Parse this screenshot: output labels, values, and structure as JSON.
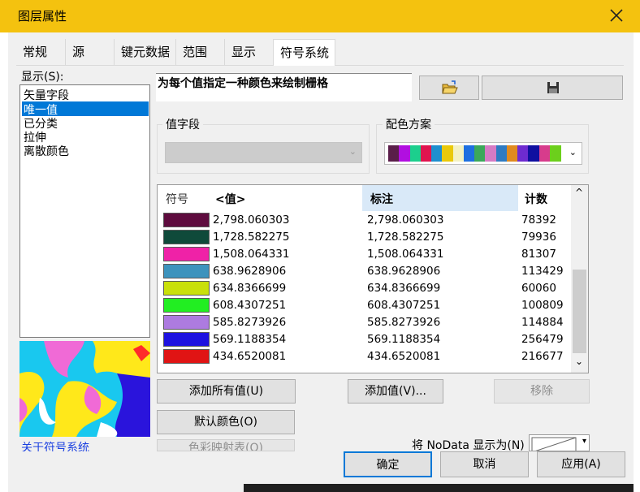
{
  "window": {
    "title": "图层属性"
  },
  "tabs": [
    "常规",
    "源",
    "键元数据",
    "范围",
    "显示",
    "符号系统"
  ],
  "show_label": "显示(S):",
  "renderers": [
    "矢量字段",
    "唯一值",
    "已分类",
    "拉伸",
    "离散颜色"
  ],
  "selected_renderer": 1,
  "description": "为每个值指定一种颜色来绘制栅格",
  "value_field": {
    "label": "值字段",
    "value": ""
  },
  "color_scheme": {
    "label": "配色方案",
    "colors": [
      "#5a1e4a",
      "#b10fe0",
      "#1ccf8d",
      "#e0144f",
      "#1e8fcf",
      "#eac90a",
      "#f3f1c3",
      "#1e6fe0",
      "#3ba85a",
      "#d67bc4",
      "#2f7bc2",
      "#e08a1e",
      "#6e2bd0",
      "#0f0fa0",
      "#d73c8c",
      "#6ccf1c"
    ]
  },
  "table": {
    "headers": {
      "symbol": "符号",
      "value": "<值>",
      "label": "标注",
      "count": "计数"
    },
    "rows": [
      {
        "color": "#5e0b3e",
        "value": "2,798.060303",
        "label": "2,798.060303",
        "count": "78392"
      },
      {
        "color": "#0f4a3a",
        "value": "1,728.582275",
        "label": "1,728.582275",
        "count": "79936"
      },
      {
        "color": "#ef22a7",
        "value": "1,508.064331",
        "label": "1,508.064331",
        "count": "81307"
      },
      {
        "color": "#3d93bd",
        "value": "638.9628906",
        "label": "638.9628906",
        "count": "113429"
      },
      {
        "color": "#c9e00a",
        "value": "634.8366699",
        "label": "634.8366699",
        "count": "60060"
      },
      {
        "color": "#22ee22",
        "value": "608.4307251",
        "label": "608.4307251",
        "count": "100809"
      },
      {
        "color": "#ad7be0",
        "value": "585.8273926",
        "label": "585.8273926",
        "count": "114884"
      },
      {
        "color": "#1e12e0",
        "value": "569.1188354",
        "label": "569.1188354",
        "count": "256479"
      },
      {
        "color": "#e01414",
        "value": "434.6520081",
        "label": "434.6520081",
        "count": "216677"
      }
    ]
  },
  "buttons": {
    "add_all": "添加所有值(U)",
    "add_value": "添加值(V)...",
    "remove": "移除",
    "default_colors": "默认颜色(O)",
    "color_map": "色彩映射表(O)",
    "ok": "确定",
    "cancel": "取消",
    "apply": "应用(A)"
  },
  "about_link": "关于符号系统",
  "nodata_label": "将 NoData 显示为(N)"
}
